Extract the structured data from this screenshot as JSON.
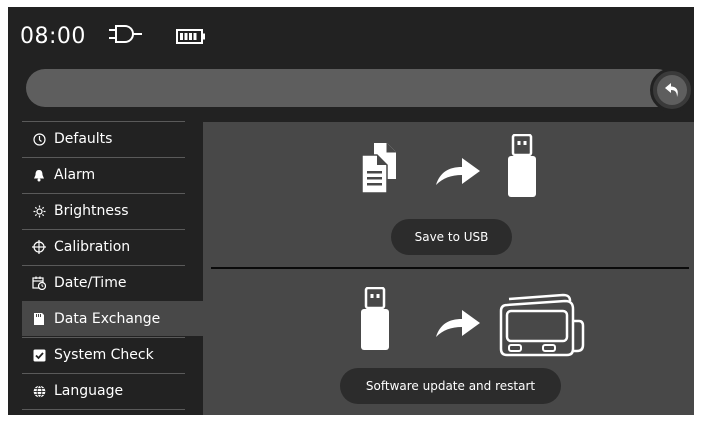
{
  "status": {
    "time": "08:00",
    "icons": [
      "plug-icon",
      "battery-icon"
    ]
  },
  "back_icon": "undo-arrow-icon",
  "sidebar": {
    "items": [
      {
        "label": "Defaults",
        "icon": "clock-icon"
      },
      {
        "label": "Alarm",
        "icon": "bell-icon"
      },
      {
        "label": "Brightness",
        "icon": "sun-icon"
      },
      {
        "label": "Calibration",
        "icon": "crosshair-icon"
      },
      {
        "label": "Date/Time",
        "icon": "calendar-clock-icon"
      },
      {
        "label": "Data Exchange",
        "icon": "sd-card-icon",
        "selected": true
      },
      {
        "label": "System Check",
        "icon": "checkbox-icon"
      },
      {
        "label": "Language",
        "icon": "globe-icon"
      }
    ]
  },
  "content": {
    "save_label": "Save to USB",
    "update_label": "Software update and restart"
  },
  "colors": {
    "screen_bg": "#222222",
    "panel_bg": "#484848",
    "bar_bg": "#5e5e5e",
    "pill_bg": "#2c2c2c",
    "text": "#ffffff"
  }
}
